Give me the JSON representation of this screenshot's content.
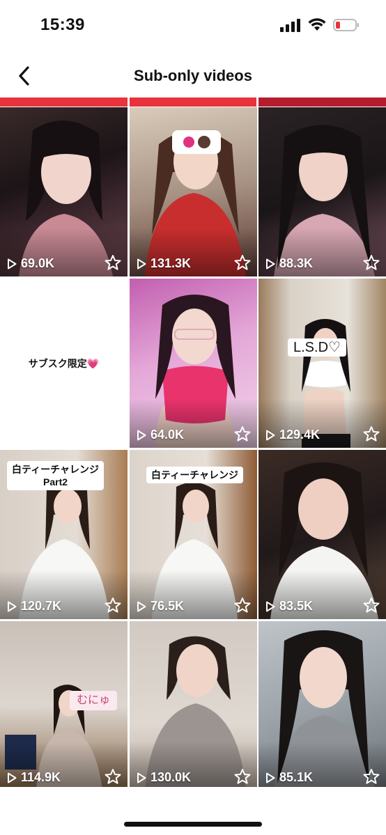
{
  "status_bar": {
    "time": "15:39",
    "icons": [
      "cellular-icon",
      "wifi-icon",
      "battery-low-icon"
    ]
  },
  "header": {
    "title": "Sub-only videos",
    "back_icon": "chevron-left-icon"
  },
  "videos": [
    {
      "views": "69.0K",
      "label": ""
    },
    {
      "views": "131.3K",
      "label": ""
    },
    {
      "views": "88.3K",
      "label": ""
    },
    {
      "views": "",
      "label": "",
      "caption": "サブスク限定💗"
    },
    {
      "views": "64.0K",
      "label": ""
    },
    {
      "views": "129.4K",
      "label": "L.S.D♡"
    },
    {
      "views": "120.7K",
      "label": "白ティーチャレンジ\nPart2"
    },
    {
      "views": "76.5K",
      "label": "白ティーチャレンジ"
    },
    {
      "views": "83.5K",
      "label": ""
    },
    {
      "views": "114.9K",
      "label": "むにゅ"
    },
    {
      "views": "130.0K",
      "label": ""
    },
    {
      "views": "85.1K",
      "label": ""
    }
  ],
  "colors": {
    "accent_strip": "#e8323c",
    "text": "#111111",
    "overlay_text": "#ffffff"
  }
}
